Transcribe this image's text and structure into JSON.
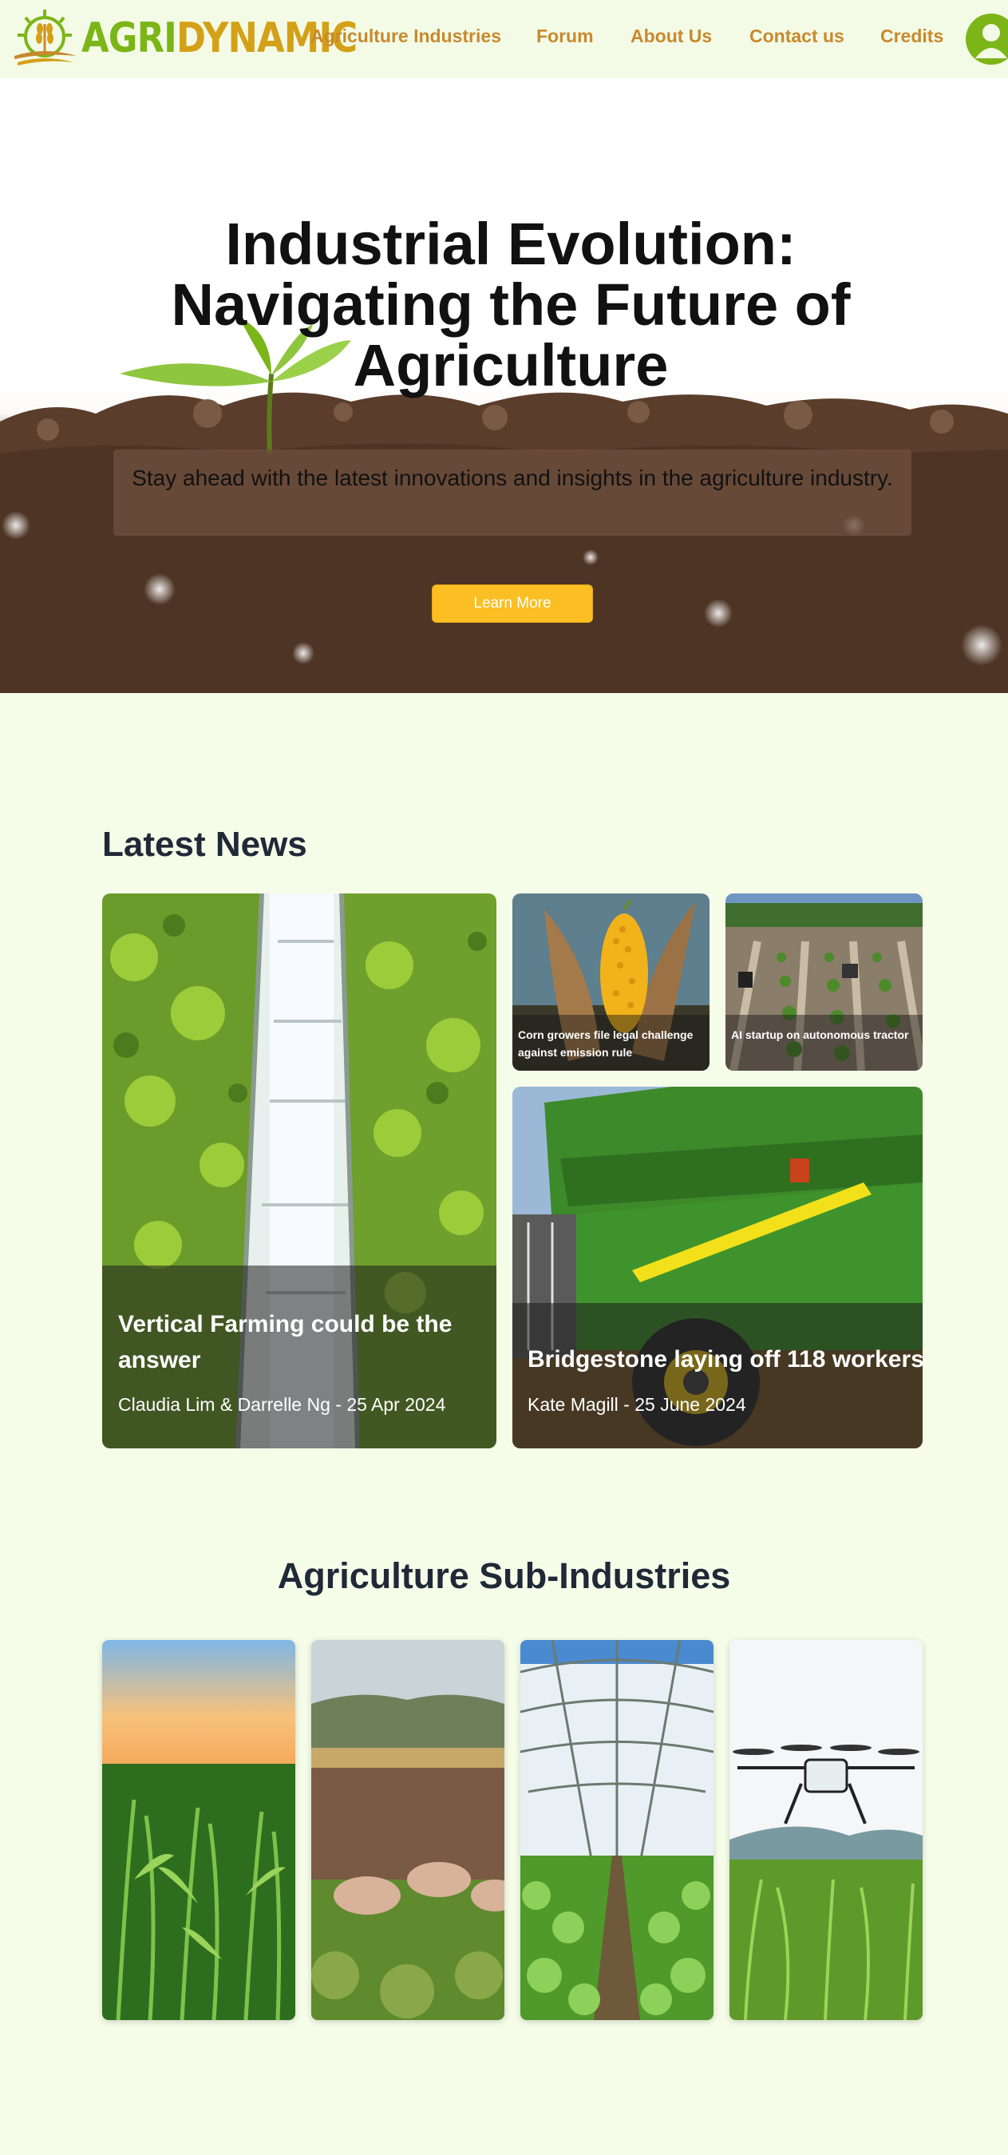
{
  "brand": {
    "agri": "AGRI",
    "dynamic": "DYNAMIC"
  },
  "nav": {
    "links": [
      "Agriculture Industries",
      "Forum",
      "About Us",
      "Contact us",
      "Credits"
    ],
    "avatar_icon": "user-avatar-icon"
  },
  "hero": {
    "title": "Industrial Evolution: Navigating the Future of Agriculture",
    "subtitle": "Stay ahead with the latest innovations and insights in the agriculture industry.",
    "button": "Learn More"
  },
  "news": {
    "heading": "Latest News",
    "featured": {
      "title": "Vertical Farming could be the answer",
      "meta": "Claudia Lim & Darrelle Ng - 25 Apr 2024"
    },
    "small": [
      {
        "title": "Corn growers file legal challenge against emission rule"
      },
      {
        "title": "AI startup on autonomous tractor"
      }
    ],
    "wide": {
      "title": "Bridgestone laying off 118 workers",
      "meta": "Kate Magill - 25 June 2024"
    }
  },
  "sub_industries": {
    "heading": "Agriculture Sub-Industries"
  },
  "colors": {
    "background": "#f5fde9",
    "brand_green": "#7cb518",
    "brand_gold": "#d4a017",
    "nav_link": "#c8892e",
    "button": "#fbbf24",
    "heading": "#1f2937"
  }
}
